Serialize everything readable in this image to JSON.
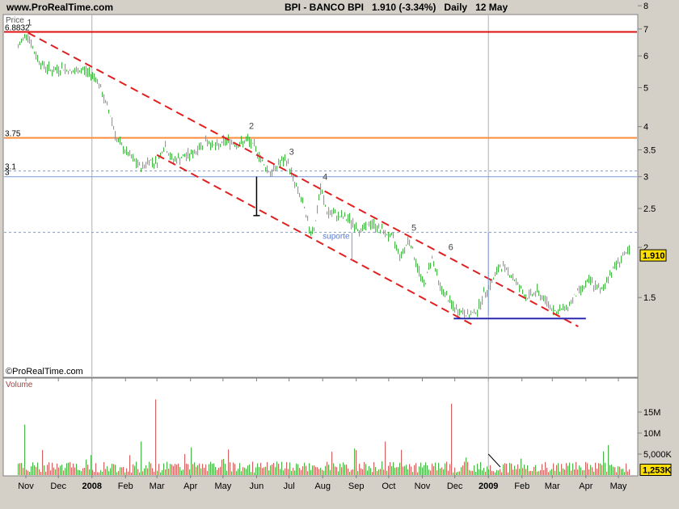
{
  "header": {
    "site": "www.ProRealTime.com",
    "symbol": "BPI - BANCO BPI",
    "last": "1.910 (-3.34%)",
    "period": "Daily",
    "date": "12 May"
  },
  "chart_data": [
    {
      "type": "bar",
      "panel": "price",
      "title": "Price",
      "watermark": "©ProRealTime.com",
      "y_scale": "log",
      "ylim": [
        1.3,
        8.3
      ],
      "y_ticks": [
        "1.5",
        "2",
        "2.5",
        "3",
        "3.5",
        "4",
        "5",
        "6",
        "7",
        "8"
      ],
      "x_ticks": [
        "Nov",
        "Dec",
        "2008",
        "Feb",
        "Mar",
        "Apr",
        "May",
        "Jun",
        "Jul",
        "Aug",
        "Sep",
        "Oct",
        "Nov",
        "Dec",
        "2009",
        "Feb",
        "Mar",
        "Apr",
        "May"
      ],
      "last_value_label": "1.910",
      "horizontal_levels": [
        {
          "value": 6.8832,
          "label": "6.8832",
          "color": "#e01010",
          "style": "solid"
        },
        {
          "value": 3.75,
          "label": "3.75",
          "color": "#ff8c3a",
          "style": "solid"
        },
        {
          "value": 3.1,
          "label": "3.1",
          "color": "#7a9ad8",
          "style": "dashed"
        },
        {
          "value": 3.0,
          "label": "3",
          "color": "#7a9ad8",
          "style": "solid"
        },
        {
          "value": 2.18,
          "label": "",
          "color": "#7a9ad8",
          "style": "dashed"
        }
      ],
      "annotations": [
        "1",
        "2",
        "3",
        "4",
        "5",
        "6",
        "suporte"
      ],
      "channel_lines": [
        "upper resistance trendline",
        "lower support trendline"
      ],
      "support_line": {
        "value": 1.33,
        "label": "suporte"
      },
      "price_path": [
        {
          "t": "2007-10-25",
          "v": 6.3
        },
        {
          "t": "2007-11-02",
          "v": 6.88
        },
        {
          "t": "2007-11-09",
          "v": 6.1
        },
        {
          "t": "2007-11-16",
          "v": 5.7
        },
        {
          "t": "2007-11-26",
          "v": 5.5
        },
        {
          "t": "2007-12-05",
          "v": 5.6
        },
        {
          "t": "2007-12-14",
          "v": 5.45
        },
        {
          "t": "2007-12-24",
          "v": 5.55
        },
        {
          "t": "2008-01-05",
          "v": 5.3
        },
        {
          "t": "2008-01-12",
          "v": 4.7
        },
        {
          "t": "2008-01-19",
          "v": 4.2
        },
        {
          "t": "2008-01-24",
          "v": 3.7
        },
        {
          "t": "2008-01-31",
          "v": 3.5
        },
        {
          "t": "2008-02-08",
          "v": 3.3
        },
        {
          "t": "2008-02-16",
          "v": 3.15
        },
        {
          "t": "2008-02-23",
          "v": 3.3
        },
        {
          "t": "2008-03-01",
          "v": 3.25
        },
        {
          "t": "2008-03-08",
          "v": 3.6
        },
        {
          "t": "2008-03-15",
          "v": 3.3
        },
        {
          "t": "2008-03-25",
          "v": 3.35
        },
        {
          "t": "2008-04-05",
          "v": 3.45
        },
        {
          "t": "2008-04-15",
          "v": 3.7
        },
        {
          "t": "2008-04-25",
          "v": 3.55
        },
        {
          "t": "2008-05-05",
          "v": 3.7
        },
        {
          "t": "2008-05-15",
          "v": 3.6
        },
        {
          "t": "2008-05-24",
          "v": 3.7
        },
        {
          "t": "2008-06-01",
          "v": 3.5
        },
        {
          "t": "2008-06-08",
          "v": 3.2
        },
        {
          "t": "2008-06-15",
          "v": 3.05
        },
        {
          "t": "2008-06-22",
          "v": 3.25
        },
        {
          "t": "2008-06-29",
          "v": 3.3
        },
        {
          "t": "2008-07-06",
          "v": 2.9
        },
        {
          "t": "2008-07-13",
          "v": 2.6
        },
        {
          "t": "2008-07-20",
          "v": 2.2
        },
        {
          "t": "2008-07-25",
          "v": 2.25
        },
        {
          "t": "2008-07-30",
          "v": 2.8
        },
        {
          "t": "2008-08-05",
          "v": 2.45
        },
        {
          "t": "2008-08-15",
          "v": 2.4
        },
        {
          "t": "2008-08-25",
          "v": 2.35
        },
        {
          "t": "2008-09-05",
          "v": 2.2
        },
        {
          "t": "2008-09-15",
          "v": 2.3
        },
        {
          "t": "2008-09-25",
          "v": 2.2
        },
        {
          "t": "2008-10-05",
          "v": 2.1
        },
        {
          "t": "2008-10-12",
          "v": 1.9
        },
        {
          "t": "2008-10-20",
          "v": 2.1
        },
        {
          "t": "2008-10-27",
          "v": 1.8
        },
        {
          "t": "2008-11-03",
          "v": 1.6
        },
        {
          "t": "2008-11-10",
          "v": 1.9
        },
        {
          "t": "2008-11-17",
          "v": 1.6
        },
        {
          "t": "2008-11-24",
          "v": 1.5
        },
        {
          "t": "2008-12-01",
          "v": 1.4
        },
        {
          "t": "2008-12-08",
          "v": 1.38
        },
        {
          "t": "2008-12-15",
          "v": 1.35
        },
        {
          "t": "2008-12-22",
          "v": 1.4
        },
        {
          "t": "2008-12-29",
          "v": 1.55
        },
        {
          "t": "2009-01-05",
          "v": 1.65
        },
        {
          "t": "2009-01-12",
          "v": 1.8
        },
        {
          "t": "2009-01-19",
          "v": 1.75
        },
        {
          "t": "2009-01-26",
          "v": 1.65
        },
        {
          "t": "2009-02-05",
          "v": 1.5
        },
        {
          "t": "2009-02-15",
          "v": 1.55
        },
        {
          "t": "2009-02-25",
          "v": 1.45
        },
        {
          "t": "2009-03-05",
          "v": 1.38
        },
        {
          "t": "2009-03-15",
          "v": 1.42
        },
        {
          "t": "2009-03-25",
          "v": 1.55
        },
        {
          "t": "2009-04-05",
          "v": 1.65
        },
        {
          "t": "2009-04-15",
          "v": 1.55
        },
        {
          "t": "2009-04-25",
          "v": 1.75
        },
        {
          "t": "2009-05-05",
          "v": 1.9
        },
        {
          "t": "2009-05-12",
          "v": 1.95
        }
      ]
    },
    {
      "type": "bar",
      "panel": "volume",
      "title": "Volume",
      "ylim": [
        0,
        19000000
      ],
      "y_ticks": [
        "5,000K",
        "10M",
        "15M"
      ],
      "last_value_label": "1,253K",
      "spikes": [
        {
          "t": "2007-11-01",
          "v": 12000000
        },
        {
          "t": "2008-03-01",
          "v": 18000000
        },
        {
          "t": "2008-02-16",
          "v": 8000000
        },
        {
          "t": "2008-09-29",
          "v": 8000000
        },
        {
          "t": "2008-11-28",
          "v": 17000000
        },
        {
          "t": "2008-10-13",
          "v": 6000000
        }
      ]
    }
  ]
}
